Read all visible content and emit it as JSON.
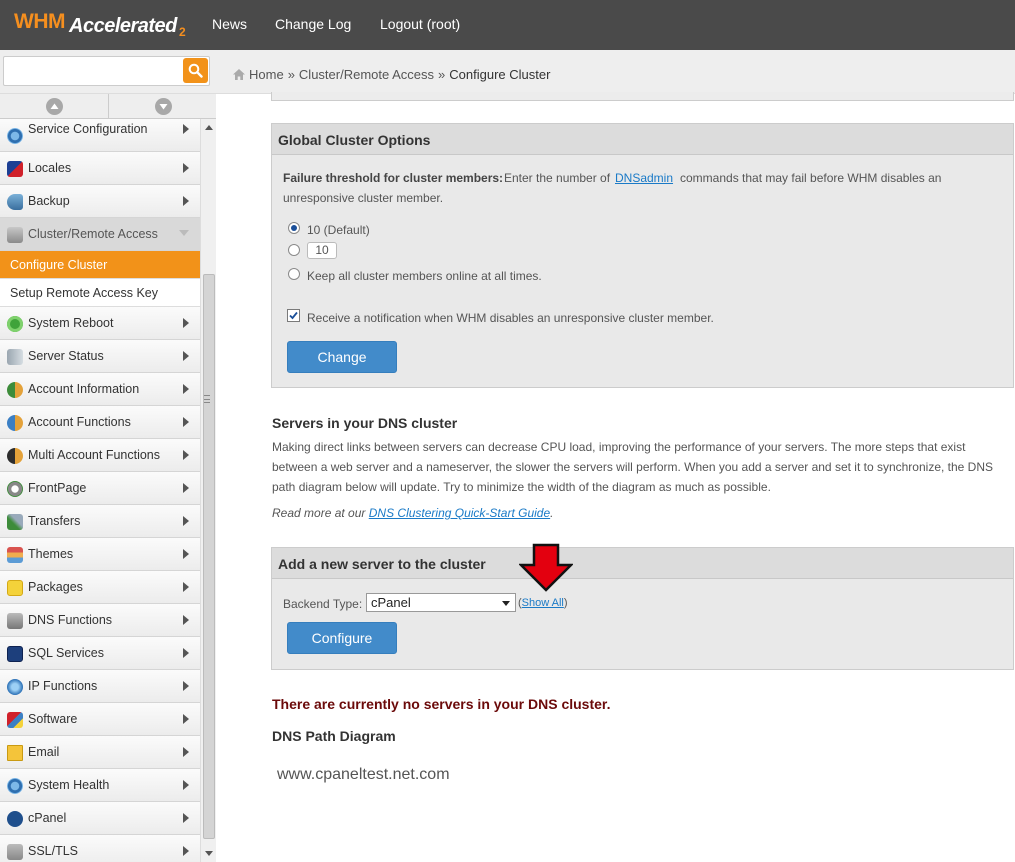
{
  "brand": {
    "whm": "WHM",
    "accelerated": "Accelerated",
    "version": "2",
    "accent": "#f29219"
  },
  "topnav": {
    "news": "News",
    "changelog": "Change Log",
    "logout": "Logout (root)"
  },
  "search": {
    "value": "",
    "placeholder": ""
  },
  "breadcrumb": {
    "home": "Home",
    "sep1": "»",
    "section": "Cluster/Remote Access",
    "sep2": "»",
    "current": "Configure Cluster"
  },
  "sidebar": {
    "items": [
      {
        "label": "Service Configuration",
        "icon": "gear-icon"
      },
      {
        "label": "Locales",
        "icon": "flag-icon"
      },
      {
        "label": "Backup",
        "icon": "backup-icon"
      },
      {
        "label": "Cluster/Remote Access",
        "icon": "cluster-icon"
      },
      {
        "label": "System Reboot",
        "icon": "power-icon"
      },
      {
        "label": "Server Status",
        "icon": "server-icon"
      },
      {
        "label": "Account Information",
        "icon": "account-info-icon"
      },
      {
        "label": "Account Functions",
        "icon": "account-functions-icon"
      },
      {
        "label": "Multi Account Functions",
        "icon": "multi-account-icon"
      },
      {
        "label": "FrontPage",
        "icon": "frontpage-icon"
      },
      {
        "label": "Transfers",
        "icon": "transfers-icon"
      },
      {
        "label": "Themes",
        "icon": "themes-icon"
      },
      {
        "label": "Packages",
        "icon": "packages-icon"
      },
      {
        "label": "DNS Functions",
        "icon": "dns-icon"
      },
      {
        "label": "SQL Services",
        "icon": "sql-icon"
      },
      {
        "label": "IP Functions",
        "icon": "ip-icon"
      },
      {
        "label": "Software",
        "icon": "software-icon"
      },
      {
        "label": "Email",
        "icon": "email-icon"
      },
      {
        "label": "System Health",
        "icon": "system-health-icon"
      },
      {
        "label": "cPanel",
        "icon": "cpanel-icon"
      },
      {
        "label": "SSL/TLS",
        "icon": "lock-icon"
      }
    ],
    "subitems": {
      "configure_cluster": "Configure Cluster",
      "setup_remote_key": "Setup Remote Access Key"
    }
  },
  "global_options": {
    "title": "Global Cluster Options",
    "threshold_label": "Failure threshold for cluster members:",
    "threshold_text_a": "Enter the number of",
    "dnsadmin_link": "DNSadmin",
    "threshold_text_b": "commands that may fail before WHM disables an",
    "threshold_text_c": "unresponsive cluster member.",
    "radio_default": "10 (Default)",
    "radio_custom_value": "10",
    "radio_keep_online": "Keep all cluster members online at all times.",
    "notify_label": "Receive a notification when WHM disables an unresponsive cluster member.",
    "change_button": "Change"
  },
  "servers_section": {
    "title": "Servers in your DNS cluster",
    "para_1": "Making direct links between servers can decrease CPU load, improving the performance of your servers. The more steps that exist",
    "para_2": "between a web server and a nameserver, the slower the servers will perform. When you add a server and set it to synchronize, the DNS",
    "para_3": "path diagram below will update. Try to minimize the width of the diagram as much as possible.",
    "read_more_prefix": "Read more at our",
    "guide_link": "DNS Clustering Quick-Start Guide",
    "read_more_suffix": "."
  },
  "add_server": {
    "title": "Add a new server to the cluster",
    "backend_label": "Backend Type:",
    "backend_value": "cPanel",
    "show_all_open": "(",
    "show_all_link": "Show All",
    "show_all_close": ")",
    "configure_button": "Configure"
  },
  "status": {
    "no_servers": "There are currently no servers in your DNS cluster.",
    "diagram_title": "DNS Path Diagram",
    "hostname": "www.cpaneltest.net.com"
  }
}
